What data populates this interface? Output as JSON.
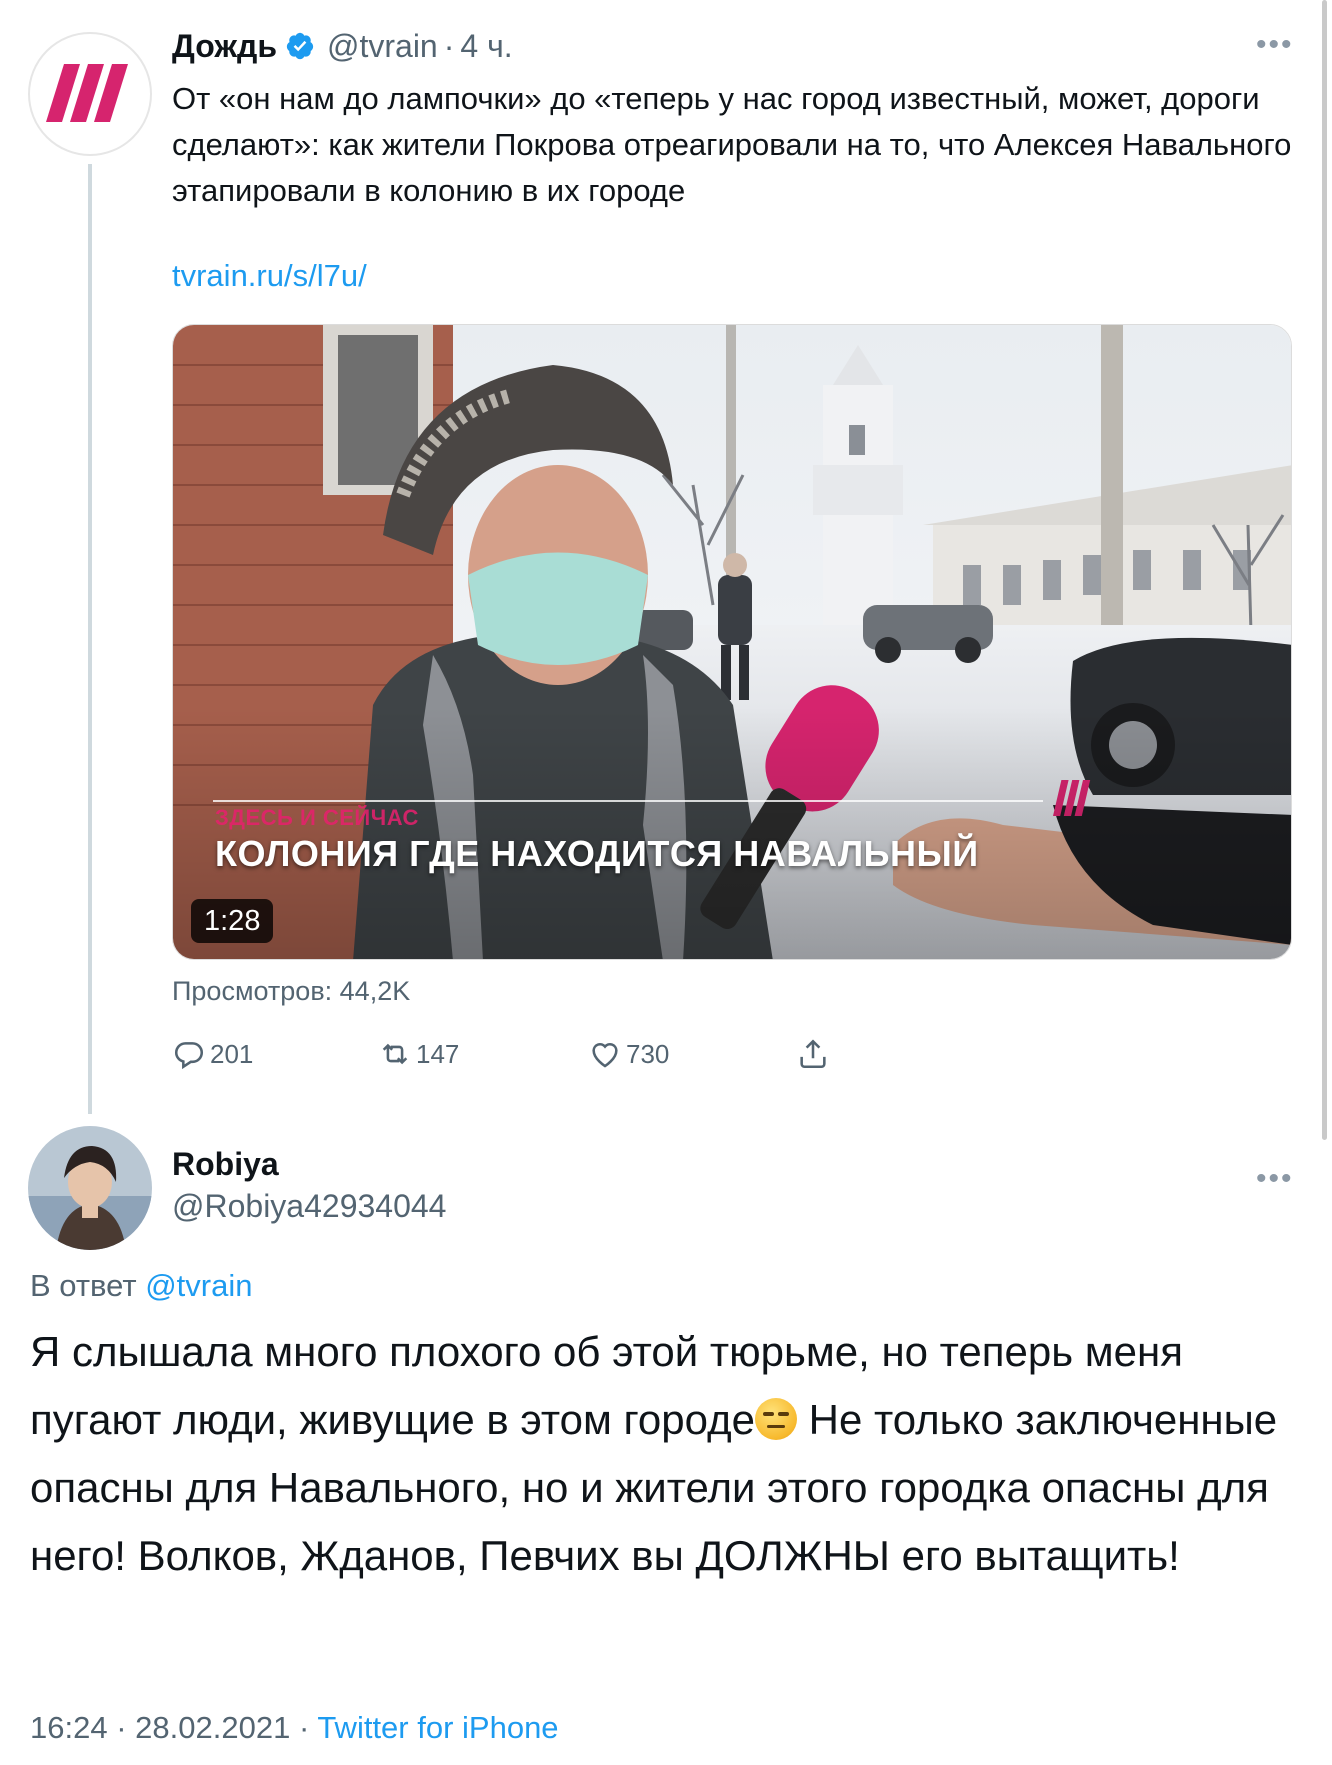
{
  "parent_tweet": {
    "author_name": "Дождь",
    "handle": "@tvrain",
    "separator": "·",
    "time": "4 ч.",
    "text": "От «он нам до лампочки» до «теперь у нас город известный, может, дороги сделают»: как жители Покрова отреагировали на то, что Алексея Навального этапировали в колонию в их городе",
    "link": "tvrain.ru/s/l7u/",
    "video": {
      "caption_small": "ЗДЕСЬ И СЕЙЧАС",
      "caption_big": "КОЛОНИЯ ГДЕ НАХОДИТСЯ НАВАЛЬНЫЙ",
      "duration": "1:28"
    },
    "views": "Просмотров: 44,2K",
    "replies": "201",
    "retweets": "147",
    "likes": "730",
    "more": "•••"
  },
  "reply_tweet": {
    "author_name": "Robiya",
    "handle": "@Robiya42934044",
    "reply_prefix": "В ответ",
    "reply_to": "@tvrain",
    "text_part1": "Я слышала много плохого об этой тюрьме, но теперь меня пугают люди, живущие в этом городе",
    "text_part2": " Не только заключенные опасны для Навального, но и жители этого городка опасны для него! Волков, Жданов, Певчих вы ДОЛЖНЫ его вытащить!",
    "time": "16:24",
    "separator1": "·",
    "date": "28.02.2021",
    "separator2": "·",
    "client": "Twitter for iPhone",
    "more": "•••"
  },
  "colors": {
    "accent": "#1d9bf0",
    "brand_rain": "#d6246e",
    "muted": "#536471"
  }
}
